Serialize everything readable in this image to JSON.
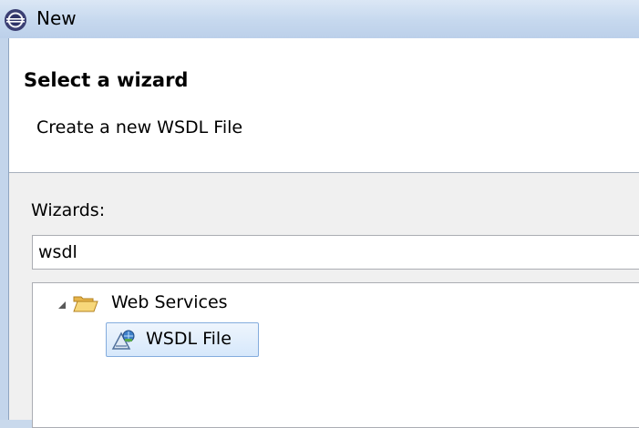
{
  "window": {
    "title": "New"
  },
  "header": {
    "heading": "Select a wizard",
    "description": "Create a new WSDL File"
  },
  "wizards": {
    "label": "Wizards:",
    "filter_value": "wsdl"
  },
  "tree": {
    "folder": {
      "label": "Web Services",
      "icon": "folder-open-icon",
      "expanded": true
    },
    "item": {
      "label": "WSDL File",
      "icon": "wsdl-file-icon",
      "selected": true
    }
  },
  "colors": {
    "titlebar": "#c6d8ee",
    "selection": "#d6e8fb",
    "selection_border": "#84acdd",
    "folder": "#f0c85a"
  }
}
